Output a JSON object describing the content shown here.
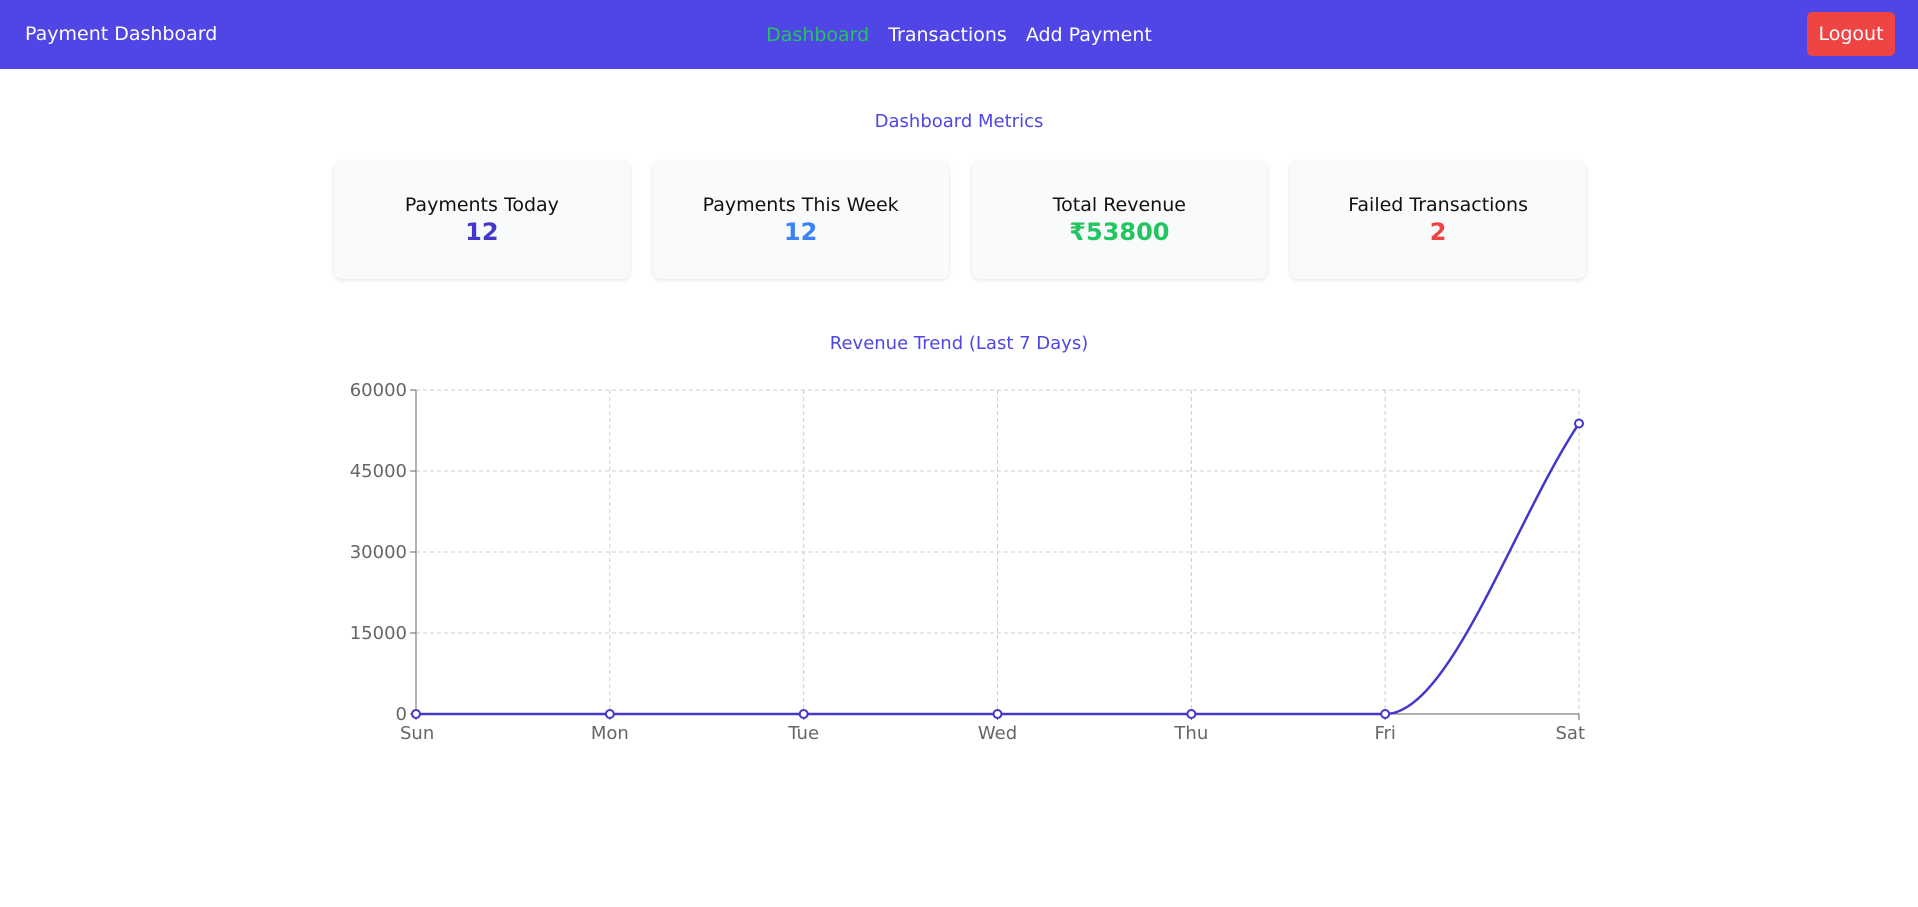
{
  "navbar": {
    "brand": "Payment Dashboard",
    "links": [
      {
        "label": "Dashboard",
        "active": true
      },
      {
        "label": "Transactions",
        "active": false
      },
      {
        "label": "Add Payment",
        "active": false
      }
    ],
    "logout_label": "Logout"
  },
  "metrics": {
    "title": "Dashboard Metrics",
    "cards": [
      {
        "label": "Payments Today",
        "value": "12",
        "color": "#4338ca"
      },
      {
        "label": "Payments This Week",
        "value": "12",
        "color": "#3b82f6"
      },
      {
        "label": "Total Revenue",
        "value": "₹53800",
        "color": "#22c55e"
      },
      {
        "label": "Failed Transactions",
        "value": "2",
        "color": "#ef4444"
      }
    ]
  },
  "colors": {
    "navbar": "#4f46e5",
    "active_link": "#22c55e",
    "logout": "#ef4444",
    "line": "#4338ca"
  },
  "chart_data": {
    "type": "line",
    "title": "Revenue Trend (Last 7 Days)",
    "categories": [
      "Sun",
      "Mon",
      "Tue",
      "Wed",
      "Thu",
      "Fri",
      "Sat"
    ],
    "values": [
      0,
      0,
      0,
      0,
      0,
      0,
      53800
    ],
    "ylim": [
      0,
      60000
    ],
    "yticks": [
      0,
      15000,
      30000,
      45000,
      60000
    ],
    "grid": true,
    "legend": "none"
  }
}
